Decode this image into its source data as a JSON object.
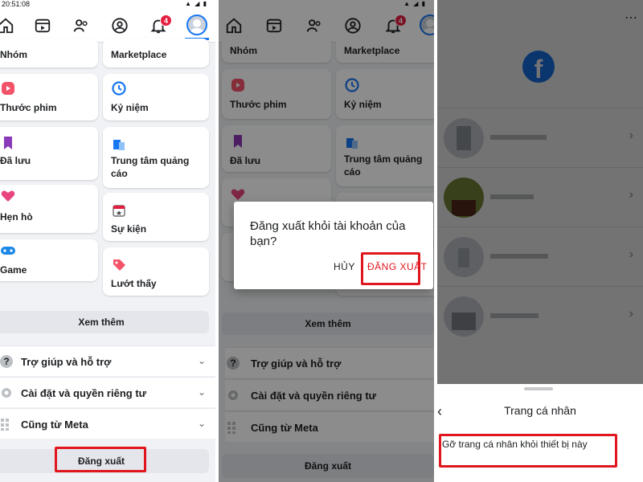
{
  "status_time": "20:51:08",
  "notifications_count": "4",
  "menu": {
    "left_column": [
      {
        "label": "Nhóm",
        "icon": "groups-icon"
      },
      {
        "label": "Thước phim",
        "icon": "reels-icon"
      },
      {
        "label": "Đã lưu",
        "icon": "saved-bookmark-icon"
      },
      {
        "label": "Hẹn hò",
        "icon": "dating-heart-icon"
      },
      {
        "label": "Game",
        "icon": "gamepad-icon"
      }
    ],
    "right_column": [
      {
        "label": "Marketplace",
        "icon": "marketplace-icon"
      },
      {
        "label": "Kỷ niệm",
        "icon": "memories-clock-icon"
      },
      {
        "label": "Trung tâm quảng cáo",
        "icon": "ads-center-icon"
      },
      {
        "label": "Sự kiện",
        "icon": "calendar-icon"
      },
      {
        "label": "Lướt thấy",
        "icon": "feeds-tag-icon"
      }
    ],
    "see_more": "Xem thêm",
    "sections": [
      {
        "label": "Trợ giúp và hỗ trợ",
        "icon": "help-icon"
      },
      {
        "label": "Cài đặt và quyền riêng tư",
        "icon": "settings-gear-icon"
      },
      {
        "label": "Cũng từ Meta",
        "icon": "meta-grid-icon"
      }
    ],
    "logout": "Đăng xuất"
  },
  "dialog": {
    "title": "Đăng xuất khỏi tài khoản của bạn?",
    "cancel": "HỦY",
    "confirm": "ĐĂNG XUẤT"
  },
  "accounts_sheet": {
    "title": "Trang cá nhân",
    "option": "Gỡ trang cá nhân khỏi thiết bị này"
  },
  "colors": {
    "accent": "#1877f2",
    "highlight_box": "#e0161e",
    "badge": "#e41e3f"
  }
}
